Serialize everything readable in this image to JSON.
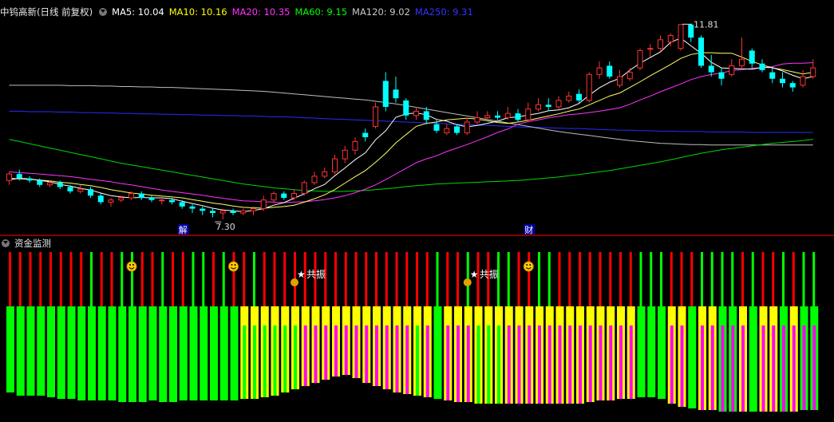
{
  "main": {
    "title": "中钨高新(日线 前复权)",
    "ma": [
      {
        "label": "MA5: 10.04",
        "color": "#ffffff"
      },
      {
        "label": "MA10: 10.16",
        "color": "#ffff00"
      },
      {
        "label": "MA20: 10.35",
        "color": "#ff33ff"
      },
      {
        "label": "MA60: 9.15",
        "color": "#00ff00"
      },
      {
        "label": "MA120: 9.02",
        "color": "#c8c8c8"
      },
      {
        "label": "MA250: 9.31",
        "color": "#3333ff"
      }
    ],
    "high_label": "11.81",
    "low_label": "7.30",
    "marker_labels": [
      "解",
      "财"
    ]
  },
  "sub": {
    "title": "资金监测",
    "resonance_label": "共振"
  },
  "colors": {
    "up": "#ff3232",
    "down": "#00ffff",
    "red": "#ff0000",
    "green": "#00ff00",
    "yellow": "#ffff00",
    "magenta": "#ff00ff",
    "border": "#b40000"
  },
  "chart_data": [
    {
      "type": "candlestick",
      "title": "中钨高新(日线 前复权)",
      "ylim": [
        7.1,
        12.0
      ],
      "high": 11.81,
      "low": 7.3,
      "candles": [
        [
          8.2,
          8.35,
          8.4,
          8.1
        ],
        [
          8.35,
          8.25,
          8.45,
          8.2
        ],
        [
          8.25,
          8.2,
          8.3,
          8.15
        ],
        [
          8.2,
          8.1,
          8.25,
          8.05
        ],
        [
          8.1,
          8.15,
          8.2,
          8.05
        ],
        [
          8.15,
          8.05,
          8.2,
          8.0
        ],
        [
          8.05,
          7.95,
          8.1,
          7.9
        ],
        [
          7.95,
          8.0,
          8.1,
          7.9
        ],
        [
          8.0,
          7.85,
          8.05,
          7.8
        ],
        [
          7.85,
          7.7,
          7.9,
          7.65
        ],
        [
          7.7,
          7.75,
          7.8,
          7.6
        ],
        [
          7.75,
          7.8,
          7.85,
          7.7
        ],
        [
          7.8,
          7.9,
          7.95,
          7.75
        ],
        [
          7.9,
          7.8,
          7.95,
          7.75
        ],
        [
          7.8,
          7.75,
          7.85,
          7.7
        ],
        [
          7.75,
          7.75,
          7.8,
          7.65
        ],
        [
          7.75,
          7.7,
          7.8,
          7.65
        ],
        [
          7.7,
          7.6,
          7.75,
          7.55
        ],
        [
          7.6,
          7.55,
          7.65,
          7.45
        ],
        [
          7.55,
          7.5,
          7.6,
          7.4
        ],
        [
          7.5,
          7.45,
          7.55,
          7.35
        ],
        [
          7.45,
          7.5,
          7.55,
          7.3
        ],
        [
          7.5,
          7.45,
          7.55,
          7.4
        ],
        [
          7.45,
          7.5,
          7.55,
          7.4
        ],
        [
          7.5,
          7.55,
          7.6,
          7.4
        ],
        [
          7.55,
          7.75,
          7.85,
          7.5
        ],
        [
          7.75,
          7.9,
          7.95,
          7.7
        ],
        [
          7.9,
          7.8,
          7.95,
          7.75
        ],
        [
          7.8,
          7.9,
          8.0,
          7.75
        ],
        [
          7.9,
          8.15,
          8.2,
          7.85
        ],
        [
          8.15,
          8.3,
          8.4,
          8.1
        ],
        [
          8.3,
          8.4,
          8.5,
          8.25
        ],
        [
          8.4,
          8.7,
          8.8,
          8.35
        ],
        [
          8.7,
          8.9,
          9.0,
          8.6
        ],
        [
          8.9,
          9.1,
          9.2,
          8.8
        ],
        [
          9.3,
          9.2,
          9.4,
          9.1
        ],
        [
          9.45,
          9.9,
          10.0,
          9.4
        ],
        [
          10.5,
          9.9,
          10.7,
          9.8
        ],
        [
          10.3,
          10.1,
          10.6,
          10.0
        ],
        [
          10.05,
          9.7,
          10.1,
          9.6
        ],
        [
          9.7,
          9.8,
          9.9,
          9.6
        ],
        [
          9.8,
          9.6,
          9.9,
          9.5
        ],
        [
          9.5,
          9.35,
          9.6,
          9.3
        ],
        [
          9.3,
          9.4,
          9.5,
          9.25
        ],
        [
          9.45,
          9.3,
          9.5,
          9.25
        ],
        [
          9.3,
          9.55,
          9.65,
          9.25
        ],
        [
          9.55,
          9.65,
          9.8,
          9.5
        ],
        [
          9.65,
          9.7,
          9.8,
          9.6
        ],
        [
          9.7,
          9.65,
          9.8,
          9.6
        ],
        [
          9.65,
          9.75,
          9.9,
          9.6
        ],
        [
          9.75,
          9.6,
          9.85,
          9.55
        ],
        [
          9.6,
          9.85,
          10.0,
          9.55
        ],
        [
          9.85,
          9.95,
          10.1,
          9.8
        ],
        [
          9.95,
          9.9,
          10.1,
          9.8
        ],
        [
          9.9,
          10.05,
          10.15,
          9.85
        ],
        [
          10.05,
          10.15,
          10.25,
          10.0
        ],
        [
          10.2,
          10.05,
          10.3,
          10.0
        ],
        [
          10.05,
          10.65,
          10.7,
          10.0
        ],
        [
          10.65,
          10.8,
          10.95,
          10.55
        ],
        [
          10.85,
          10.6,
          10.95,
          10.55
        ],
        [
          10.4,
          10.6,
          10.75,
          10.35
        ],
        [
          10.55,
          10.7,
          10.8,
          10.5
        ],
        [
          10.8,
          11.2,
          11.25,
          10.75
        ],
        [
          11.25,
          11.25,
          11.35,
          11.05
        ],
        [
          11.25,
          11.45,
          11.55,
          11.2
        ],
        [
          11.4,
          11.55,
          11.6,
          11.3
        ],
        [
          11.25,
          11.8,
          11.81,
          11.2
        ],
        [
          11.8,
          11.5,
          11.81,
          11.4
        ],
        [
          11.5,
          10.85,
          11.55,
          10.8
        ],
        [
          10.85,
          10.7,
          11.1,
          10.6
        ],
        [
          10.7,
          10.55,
          10.8,
          10.4
        ],
        [
          10.65,
          10.85,
          11.0,
          10.6
        ],
        [
          10.85,
          11.0,
          11.5,
          10.8
        ],
        [
          11.2,
          10.9,
          11.25,
          10.8
        ],
        [
          10.9,
          10.75,
          11.0,
          10.7
        ],
        [
          10.7,
          10.55,
          10.8,
          10.45
        ],
        [
          10.55,
          10.45,
          10.7,
          10.35
        ],
        [
          10.45,
          10.35,
          10.5,
          10.25
        ],
        [
          10.4,
          10.6,
          10.75,
          10.35
        ],
        [
          10.6,
          10.8,
          11.0,
          10.55
        ]
      ],
      "ma": {
        "MA5": [
          8.22,
          8.25,
          8.24,
          8.2,
          8.17,
          8.11,
          8.07,
          8.02,
          7.98,
          7.91,
          7.85,
          7.82,
          7.8,
          7.81,
          7.8,
          7.8,
          7.78,
          7.72,
          7.67,
          7.62,
          7.56,
          7.52,
          7.5,
          7.48,
          7.51,
          7.55,
          7.63,
          7.69,
          7.79,
          7.89,
          8.01,
          8.11,
          8.31,
          8.49,
          8.68,
          8.84,
          9.14,
          9.35,
          9.66,
          9.74,
          9.76,
          9.72,
          9.61,
          9.57,
          9.49,
          9.44,
          9.47,
          9.52,
          9.57,
          9.65,
          9.67,
          9.71,
          9.75,
          9.81,
          9.83,
          9.88,
          9.98,
          10.17,
          10.34,
          10.47,
          10.56,
          10.75,
          10.91,
          11.04,
          11.17,
          11.39,
          11.49,
          11.31,
          11.14,
          10.93,
          10.8,
          10.79,
          10.78,
          10.77,
          10.81,
          10.81,
          10.73,
          10.63,
          10.55,
          10.6
        ],
        "MA10": [
          8.25,
          8.24,
          8.23,
          8.21,
          8.19,
          8.16,
          8.14,
          8.11,
          8.08,
          8.04,
          7.99,
          7.95,
          7.91,
          7.89,
          7.86,
          7.84,
          7.82,
          7.8,
          7.76,
          7.72,
          7.68,
          7.65,
          7.61,
          7.58,
          7.57,
          7.56,
          7.58,
          7.6,
          7.63,
          7.7,
          7.78,
          7.87,
          7.99,
          8.14,
          8.29,
          8.43,
          8.62,
          8.83,
          9.07,
          9.26,
          9.45,
          9.52,
          9.55,
          9.6,
          9.62,
          9.64,
          9.62,
          9.58,
          9.54,
          9.52,
          9.55,
          9.59,
          9.64,
          9.69,
          9.74,
          9.8,
          9.85,
          9.95,
          10.05,
          10.15,
          10.22,
          10.35,
          10.48,
          10.62,
          10.75,
          10.88,
          11.02,
          11.11,
          11.15,
          11.15,
          11.14,
          11.14,
          11.05,
          10.95,
          10.87,
          10.8,
          10.76,
          10.71,
          10.66,
          10.7
        ],
        "MA20": [
          8.4,
          8.38,
          8.37,
          8.35,
          8.33,
          8.31,
          8.29,
          8.26,
          8.23,
          8.2,
          8.17,
          8.13,
          8.1,
          8.06,
          8.02,
          7.98,
          7.95,
          7.92,
          7.89,
          7.86,
          7.82,
          7.79,
          7.76,
          7.73,
          7.72,
          7.71,
          7.7,
          7.69,
          7.7,
          7.71,
          7.73,
          7.76,
          7.8,
          7.85,
          7.92,
          8.0,
          8.1,
          8.22,
          8.35,
          8.48,
          8.61,
          8.7,
          8.77,
          8.87,
          8.95,
          9.03,
          9.12,
          9.21,
          9.31,
          9.39,
          9.5,
          9.56,
          9.6,
          9.65,
          9.68,
          9.72,
          9.74,
          9.77,
          9.8,
          9.84,
          9.88,
          9.96,
          10.06,
          10.15,
          10.25,
          10.34,
          10.43,
          10.53,
          10.6,
          10.65,
          10.68,
          10.74,
          10.76,
          10.79,
          10.81,
          10.83,
          10.89,
          10.91,
          10.91,
          10.92
        ],
        "MA60": [
          9.15,
          9.1,
          9.05,
          9.0,
          8.95,
          8.9,
          8.85,
          8.8,
          8.75,
          8.7,
          8.65,
          8.6,
          8.56,
          8.52,
          8.48,
          8.44,
          8.4,
          8.36,
          8.32,
          8.28,
          8.24,
          8.2,
          8.16,
          8.12,
          8.09,
          8.06,
          8.03,
          8.01,
          7.99,
          7.97,
          7.96,
          7.95,
          7.95,
          7.95,
          7.96,
          7.97,
          7.99,
          8.01,
          8.03,
          8.06,
          8.08,
          8.1,
          8.12,
          8.13,
          8.14,
          8.15,
          8.16,
          8.17,
          8.18,
          8.19,
          8.2,
          8.22,
          8.24,
          8.26,
          8.28,
          8.31,
          8.34,
          8.37,
          8.4,
          8.43,
          8.47,
          8.51,
          8.55,
          8.59,
          8.63,
          8.68,
          8.73,
          8.78,
          8.83,
          8.87,
          8.91,
          8.94,
          8.97,
          9.0,
          9.03,
          9.06,
          9.08,
          9.1,
          9.12,
          9.15
        ],
        "MA120": [
          10.4,
          10.4,
          10.4,
          10.4,
          10.4,
          10.4,
          10.39,
          10.39,
          10.39,
          10.38,
          10.38,
          10.37,
          10.37,
          10.36,
          10.36,
          10.35,
          10.35,
          10.34,
          10.33,
          10.32,
          10.31,
          10.3,
          10.29,
          10.28,
          10.27,
          10.26,
          10.24,
          10.22,
          10.2,
          10.18,
          10.16,
          10.14,
          10.12,
          10.1,
          10.08,
          10.06,
          10.03,
          10.0,
          9.97,
          9.93,
          9.89,
          9.85,
          9.81,
          9.77,
          9.73,
          9.69,
          9.65,
          9.61,
          9.57,
          9.53,
          9.49,
          9.45,
          9.41,
          9.37,
          9.33,
          9.3,
          9.27,
          9.24,
          9.21,
          9.18,
          9.15,
          9.12,
          9.1,
          9.08,
          9.06,
          9.05,
          9.04,
          9.03,
          9.03,
          9.02,
          9.02,
          9.02,
          9.02,
          9.02,
          9.02,
          9.02,
          9.02,
          9.02,
          9.02,
          9.02
        ],
        "MA250": [
          9.8,
          9.8,
          9.79,
          9.79,
          9.79,
          9.78,
          9.78,
          9.77,
          9.77,
          9.76,
          9.76,
          9.75,
          9.75,
          9.74,
          9.74,
          9.73,
          9.73,
          9.72,
          9.72,
          9.71,
          9.71,
          9.7,
          9.7,
          9.69,
          9.69,
          9.68,
          9.67,
          9.67,
          9.66,
          9.65,
          9.64,
          9.63,
          9.62,
          9.61,
          9.6,
          9.59,
          9.58,
          9.57,
          9.56,
          9.55,
          9.54,
          9.53,
          9.52,
          9.51,
          9.5,
          9.49,
          9.48,
          9.47,
          9.46,
          9.45,
          9.44,
          9.43,
          9.43,
          9.42,
          9.41,
          9.4,
          9.4,
          9.39,
          9.38,
          9.37,
          9.36,
          9.36,
          9.35,
          9.35,
          9.34,
          9.34,
          9.33,
          9.33,
          9.33,
          9.32,
          9.32,
          9.32,
          9.32,
          9.31,
          9.31,
          9.31,
          9.31,
          9.31,
          9.31,
          9.31
        ]
      }
    },
    {
      "type": "bar",
      "title": "资金监测",
      "ylim": [
        0,
        100
      ],
      "top_color": [
        "r",
        "r",
        "r",
        "r",
        "r",
        "r",
        "r",
        "r",
        "g",
        "r",
        "r",
        "g",
        "g",
        "r",
        "r",
        "g",
        "r",
        "r",
        "g",
        "g",
        "r",
        "g",
        "r",
        "r",
        "g",
        "r",
        "r",
        "r",
        "r",
        "r",
        "r",
        "r",
        "r",
        "r",
        "r",
        "r",
        "r",
        "r",
        "r",
        "r",
        "r",
        "r",
        "g",
        "r",
        "r",
        "g",
        "r",
        "r",
        "g",
        "g",
        "r",
        "r",
        "g",
        "g",
        "r",
        "r",
        "r",
        "r",
        "r",
        "r",
        "r",
        "r",
        "g",
        "g",
        "g",
        "r",
        "r",
        "r",
        "g",
        "g",
        "g",
        "g",
        "r",
        "g",
        "r",
        "r",
        "g",
        "r",
        "g",
        "g"
      ],
      "base": [
        "g",
        "g",
        "g",
        "g",
        "g",
        "g",
        "g",
        "g",
        "g",
        "g",
        "g",
        "g",
        "g",
        "g",
        "g",
        "g",
        "g",
        "g",
        "g",
        "g",
        "g",
        "g",
        "g",
        "y",
        "y",
        "y",
        "y",
        "y",
        "y",
        "y",
        "y",
        "y",
        "y",
        "y",
        "y",
        "y",
        "y",
        "y",
        "y",
        "y",
        "y",
        "y",
        "g",
        "y",
        "y",
        "y",
        "y",
        "y",
        "y",
        "y",
        "y",
        "y",
        "y",
        "y",
        "y",
        "y",
        "y",
        "y",
        "y",
        "y",
        "y",
        "y",
        "g",
        "g",
        "g",
        "y",
        "y",
        "g",
        "y",
        "y",
        "g",
        "g",
        "y",
        "g",
        "y",
        "y",
        "g",
        "y",
        "g",
        "g"
      ],
      "inner": [
        "n",
        "n",
        "n",
        "n",
        "n",
        "n",
        "n",
        "n",
        "n",
        "n",
        "n",
        "n",
        "n",
        "n",
        "n",
        "n",
        "n",
        "n",
        "n",
        "n",
        "n",
        "n",
        "n",
        "g",
        "g",
        "g",
        "g",
        "g",
        "g",
        "m",
        "m",
        "m",
        "m",
        "m",
        "m",
        "m",
        "m",
        "m",
        "m",
        "m",
        "g",
        "m",
        "n",
        "m",
        "m",
        "m",
        "g",
        "g",
        "g",
        "m",
        "m",
        "m",
        "m",
        "m",
        "m",
        "m",
        "m",
        "m",
        "m",
        "m",
        "m",
        "m",
        "n",
        "n",
        "n",
        "m",
        "m",
        "n",
        "m",
        "m",
        "m",
        "m",
        "m",
        "n",
        "m",
        "m",
        "m",
        "m",
        "m",
        "m"
      ],
      "bottom": [
        88,
        90,
        90,
        90,
        91,
        92,
        92,
        93,
        93,
        93,
        93,
        94,
        94,
        94,
        93,
        94,
        94,
        93,
        93,
        93,
        93,
        93,
        93,
        92,
        92,
        91,
        90,
        88,
        86,
        84,
        82,
        80,
        78,
        77,
        79,
        82,
        84,
        86,
        88,
        89,
        90,
        91,
        92,
        93,
        94,
        94,
        95,
        95,
        95,
        95,
        95,
        95,
        95,
        95,
        95,
        95,
        95,
        94,
        93,
        93,
        92,
        92,
        91,
        91,
        92,
        95,
        97,
        98,
        99,
        99,
        100,
        100,
        100,
        100,
        100,
        100,
        100,
        100,
        99,
        99
      ],
      "resonance_days": [
        28,
        45
      ]
    }
  ]
}
